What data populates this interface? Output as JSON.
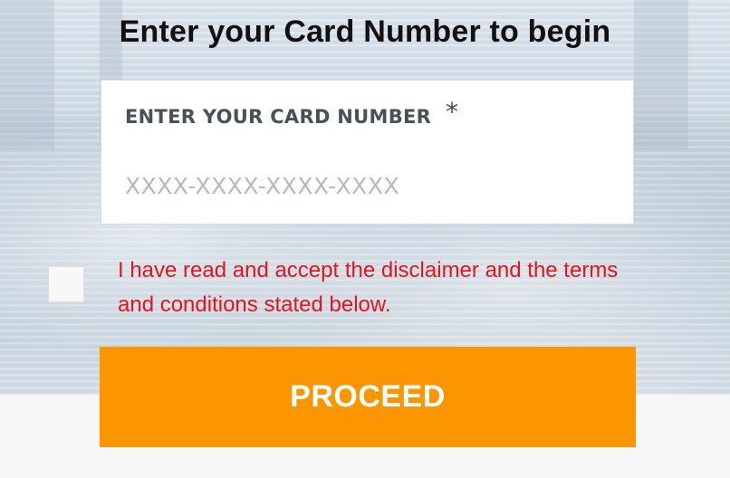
{
  "page": {
    "title": "Enter your Card Number to begin"
  },
  "card_field": {
    "label": "ENTER YOUR CARD NUMBER",
    "required_marker": "*",
    "placeholder": "XXXX-XXXX-XXXX-XXXX",
    "value": ""
  },
  "terms": {
    "checked": false,
    "text": "I have read and accept the disclaimer and the terms and conditions stated below."
  },
  "actions": {
    "proceed_label": "PROCEED"
  },
  "colors": {
    "accent": "#fb9600",
    "error_text": "#e3141e",
    "label_text": "#4a5058"
  }
}
